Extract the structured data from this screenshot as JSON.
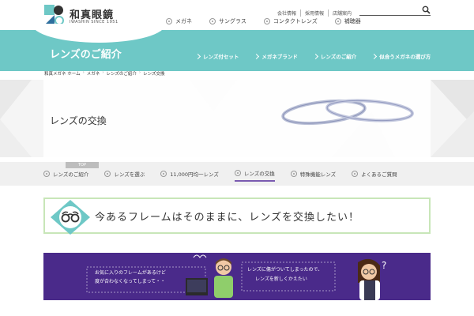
{
  "brand": {
    "name": "和真眼鏡",
    "sub": "IWASHIN SINCE 1951"
  },
  "utility_links": [
    "会社情報",
    "採用情報",
    "店舗案内"
  ],
  "search": {
    "placeholder": ""
  },
  "main_nav": [
    "メガネ",
    "サングラス",
    "コンタクトレンズ",
    "補聴器"
  ],
  "section": {
    "title": "レンズのご紹介",
    "subnav": [
      "レンズ付セット",
      "メガネブランド",
      "レンズのご紹介",
      "似合うメガネの選び方"
    ]
  },
  "breadcrumb": [
    "和真メガネ ホーム",
    "メガネ",
    "レンズのご紹介",
    "レンズ交換"
  ],
  "hero": {
    "title": "レンズの交換"
  },
  "tabs": {
    "top_label": "TOP",
    "items": [
      "レンズのご紹介",
      "レンズを選ぶ",
      "11,000円均一レンズ",
      "レンズの交換",
      "特殊機能レンズ",
      "よくあるご質問"
    ],
    "active_index": 3
  },
  "banner": {
    "text": "今あるフレームはそのままに、レンズを交換したい！"
  },
  "promo": {
    "left_bubble_line1": "お気に入りのフレームがあるけど",
    "left_bubble_line2": "度が合わなくなってしまって・・",
    "right_bubble_line1": "レンズに傷がついてしまったので、",
    "right_bubble_line2": "レンズを新しくかえたい"
  },
  "colors": {
    "teal": "#6ec8c6",
    "purple": "#4a2a8a",
    "green_border": "#c8e6b8",
    "active_tab": "#7a5bb0"
  }
}
